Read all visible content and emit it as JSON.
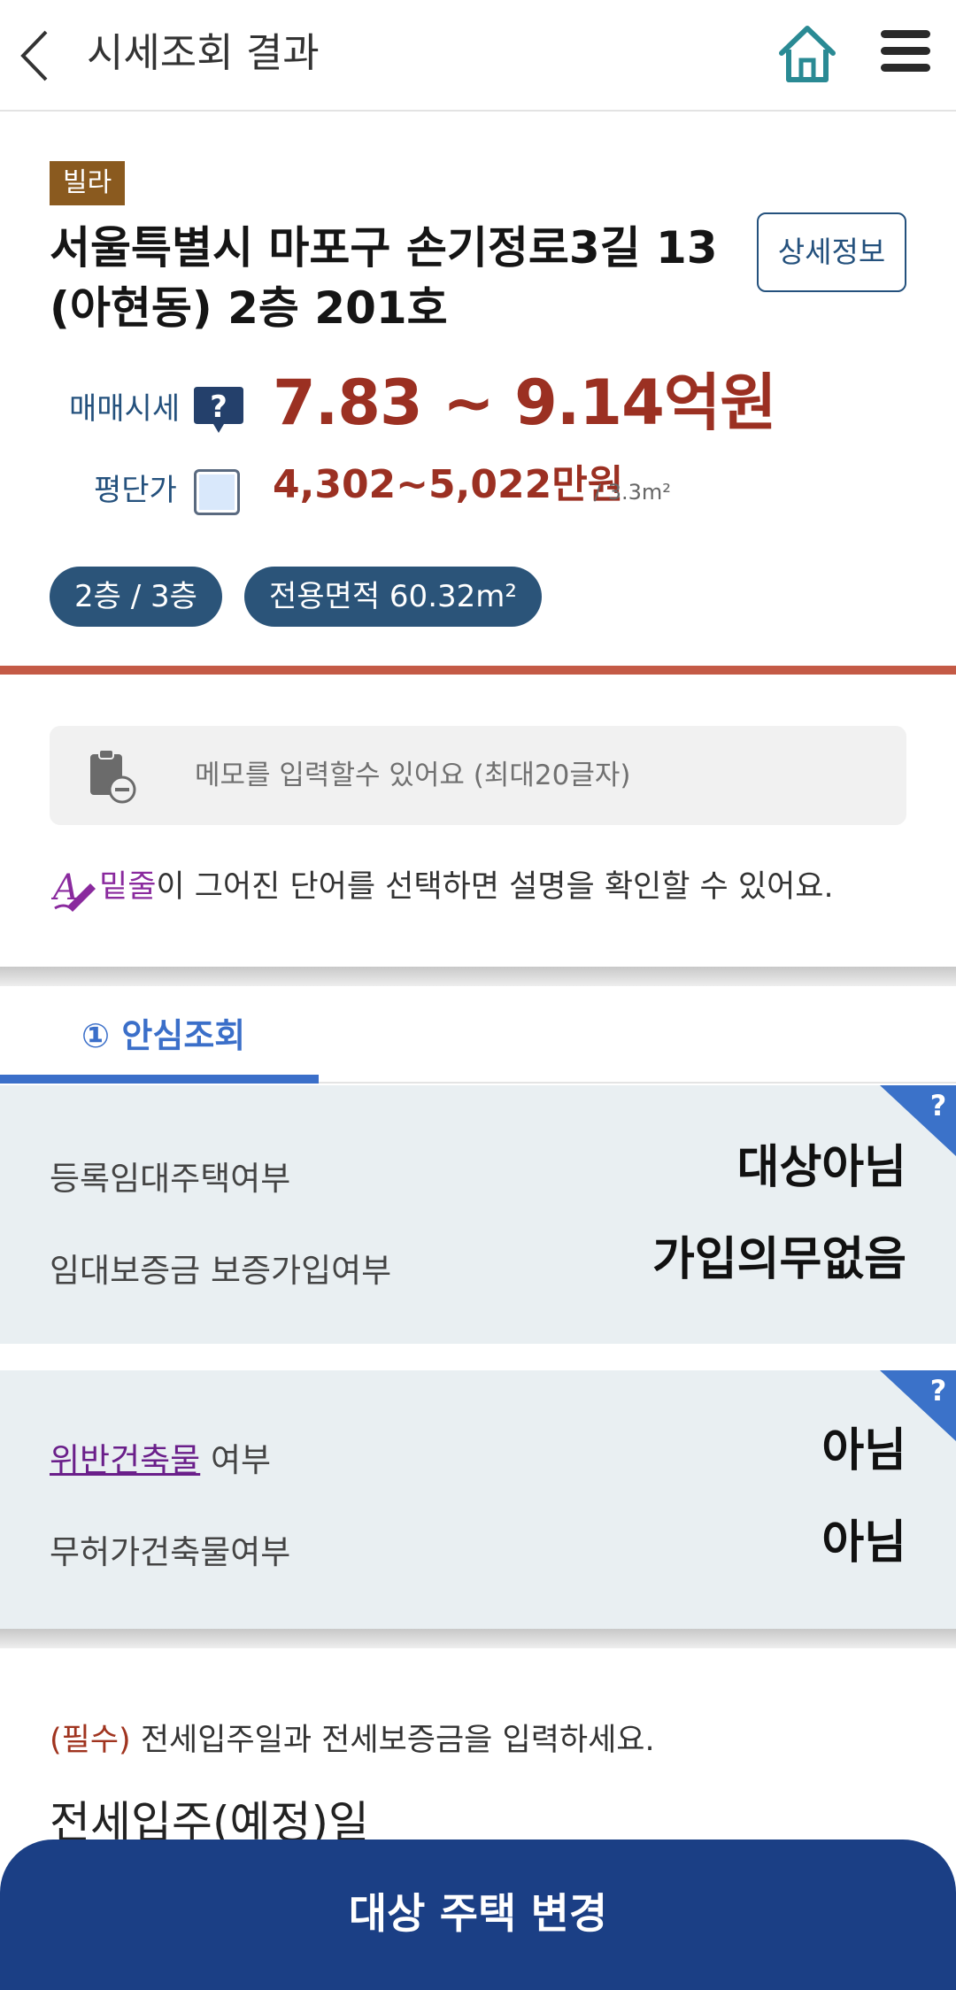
{
  "header": {
    "title": "시세조회 결과",
    "home_icon": "home-icon",
    "menu_icon": "hamburger-menu-icon",
    "back_icon": "chevron-left-icon"
  },
  "property": {
    "type": "빌라",
    "address_line1": "서울특별시 마포구 손기정로3길 13",
    "address_line2": "(아현동) 2층 201호",
    "detail_button": "상세정보",
    "price_label": "매매시세",
    "price_value": "7.83 ~ 9.14억원",
    "unit_label": "평단가",
    "unit_value": "4,302~5,022만원",
    "unit_suffix": "/ 3.3m²",
    "floor_pill": "2층 / 3층",
    "area_pill": "전용면적 60.32m²"
  },
  "memo": {
    "placeholder": "메모를 입력할수 있어요 (최대20글자)"
  },
  "hint": {
    "underline_word": "밑줄",
    "rest": "이 그어진 단어를 선택하면 설명을 확인할 수 있어요."
  },
  "tabs": [
    {
      "label": "① 안심조회",
      "active": true
    }
  ],
  "panels": [
    {
      "rows": [
        {
          "label": "등록임대주택여부",
          "value": "대상아님"
        },
        {
          "label": "임대보증금 보증가입여부",
          "value": "가입의무없음"
        }
      ]
    },
    {
      "rows": [
        {
          "label_link": "위반건축물",
          "label_rest": " 여부",
          "value": "아님"
        },
        {
          "label": "무허가건축물여부",
          "value": "아님"
        }
      ]
    }
  ],
  "required": {
    "mark": "(필수)",
    "text": " 전세입주일과 전세보증금을 입력하세요."
  },
  "move_in_title": "전세입주(예정)일",
  "bottom_button": "대상 주택 변경",
  "colors": {
    "accent_blue": "#3b6fc9",
    "navy": "#1b3f85",
    "price_red": "#9b3022",
    "badge_brown": "#8a5a1f",
    "pill_blue": "#2b5479"
  }
}
